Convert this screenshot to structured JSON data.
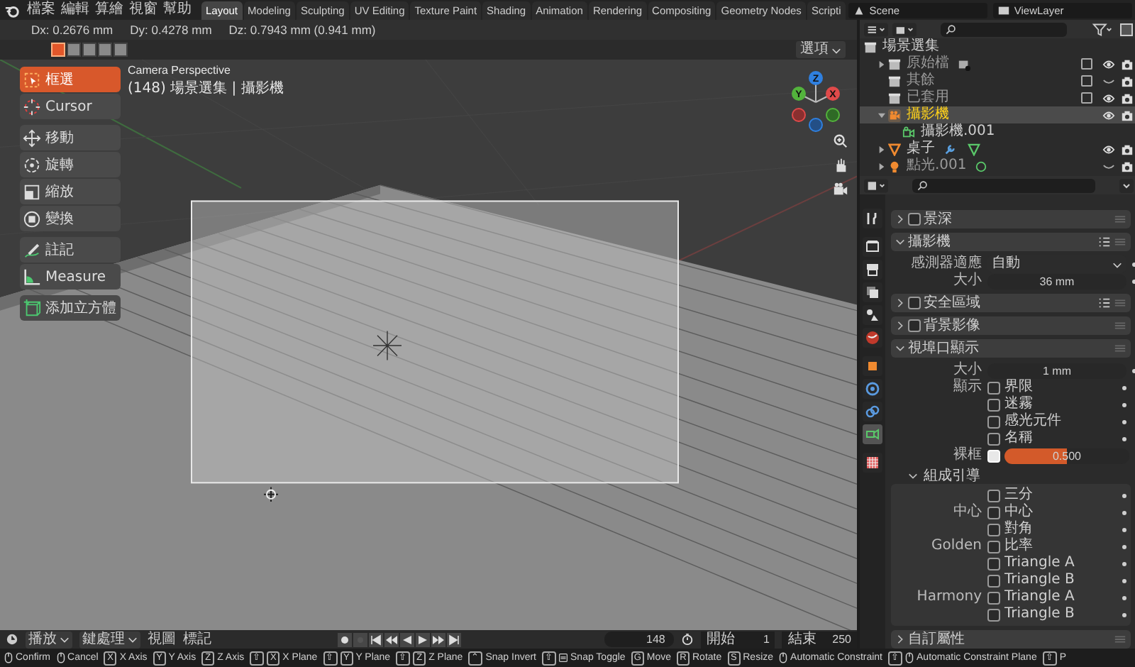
{
  "menu": [
    "檔案",
    "編輯",
    "算繪",
    "視窗",
    "幫助"
  ],
  "workspaces": [
    {
      "label": "Layout",
      "selected": true
    },
    {
      "label": "Modeling",
      "selected": false
    },
    {
      "label": "Sculpting",
      "selected": false
    },
    {
      "label": "UV Editing",
      "selected": false
    },
    {
      "label": "Texture Paint",
      "selected": false
    },
    {
      "label": "Shading",
      "selected": false
    },
    {
      "label": "Animation",
      "selected": false
    },
    {
      "label": "Rendering",
      "selected": false
    },
    {
      "label": "Compositing",
      "selected": false
    },
    {
      "label": "Geometry Nodes",
      "selected": false
    },
    {
      "label": "Scripti",
      "selected": false
    }
  ],
  "scene": "Scene",
  "view_layer": "ViewLayer",
  "viewport": {
    "measurements": [
      "Dx: 0.2676 mm",
      "Dy: 0.4278 mm",
      "Dz: 0.7943 mm (0.941 mm)"
    ],
    "select_modes": [
      {
        "selected": true
      },
      {
        "selected": false
      },
      {
        "selected": false
      },
      {
        "selected": false
      },
      {
        "selected": false
      }
    ],
    "options": "選項",
    "camera_title": "Camera Perspective",
    "camera_info": "(148) 場景選集 | 攝影機",
    "tool_groups": [
      [
        {
          "label": "框選",
          "kind": "select-box",
          "selected": true
        },
        {
          "label": "Cursor",
          "kind": "cursor",
          "selected": false
        }
      ],
      [
        {
          "label": "移動",
          "kind": "move",
          "selected": false
        },
        {
          "label": "旋轉",
          "kind": "rotate",
          "selected": false
        },
        {
          "label": "縮放",
          "kind": "scale",
          "selected": false
        },
        {
          "label": "變換",
          "kind": "transform",
          "selected": false
        }
      ],
      [
        {
          "label": "註記",
          "kind": "annotate",
          "selected": false
        },
        {
          "label": "Measure",
          "kind": "measure",
          "selected": false
        }
      ],
      [
        {
          "label": "添加立方體",
          "kind": "add-cube",
          "selected": false
        }
      ]
    ],
    "gizmo": [
      {
        "label": "Z",
        "color": "#2f80e0"
      },
      {
        "label": "Y",
        "color": "#53b33c"
      },
      {
        "label": "X",
        "color": "#e04a4a"
      }
    ]
  },
  "timeline": {
    "menus": [
      "播放",
      "鍵處理"
    ],
    "links": [
      "視圖",
      "標記"
    ],
    "frame": "148",
    "start_label": "開始",
    "start": "1",
    "end_label": "結束",
    "end": "250"
  },
  "outliner": {
    "root": "場景選集",
    "items": [
      {
        "label": "原始檔",
        "kind": "collection",
        "expanded": false,
        "dimmed": true,
        "selected": false,
        "visible": true,
        "extras": [
          {
            "kind": "collection-count"
          }
        ]
      },
      {
        "label": "其餘",
        "kind": "collection",
        "dimmed": true,
        "selected": false,
        "visible": false
      },
      {
        "label": "已套用",
        "kind": "collection",
        "dimmed": true,
        "selected": false,
        "visible": true
      },
      {
        "label": "攝影機",
        "kind": "camera",
        "expanded": true,
        "dimmed": false,
        "selected": true,
        "visible": true,
        "children": [
          {
            "label": "攝影機.001",
            "kind": "camera-data"
          }
        ]
      },
      {
        "label": "桌子",
        "kind": "mesh",
        "expanded": false,
        "dimmed": false,
        "selected": false,
        "visible": true,
        "extras": [
          {
            "kind": "modifier"
          },
          {
            "kind": "mesh-data"
          }
        ]
      },
      {
        "label": "點光.001",
        "kind": "light",
        "expanded": false,
        "dimmed": true,
        "selected": false,
        "visible": false,
        "extras": [
          {
            "kind": "light-data"
          }
        ]
      }
    ]
  },
  "properties": {
    "tabs": [
      [
        {
          "kind": "tool",
          "selected": false
        }
      ],
      [
        {
          "kind": "render",
          "selected": false
        },
        {
          "kind": "output",
          "selected": false
        },
        {
          "kind": "view-layer",
          "selected": false
        },
        {
          "kind": "scene",
          "selected": false
        },
        {
          "kind": "world",
          "selected": false
        }
      ],
      [
        {
          "kind": "object",
          "selected": false
        },
        {
          "kind": "physics",
          "selected": false
        },
        {
          "kind": "constraint",
          "selected": false
        },
        {
          "kind": "camera-data",
          "selected": true
        }
      ],
      [
        {
          "kind": "texture",
          "selected": false
        }
      ]
    ],
    "panels": [
      {
        "title": "景深",
        "expanded": false,
        "checked": false
      },
      {
        "title": "攝影機",
        "expanded": true,
        "presets": true,
        "rows": [
          {
            "kind": "dropdown",
            "label": "感測器適應",
            "value": "自動"
          },
          {
            "kind": "number",
            "label": "大小",
            "value": "36 mm"
          }
        ]
      },
      {
        "title": "安全區域",
        "expanded": false,
        "checked": false,
        "presets": true
      },
      {
        "title": "背景影像",
        "expanded": false,
        "checked": false
      },
      {
        "title": "視埠口顯示",
        "expanded": true,
        "rows": [
          {
            "kind": "number",
            "label": "大小",
            "value": "1 mm"
          },
          {
            "kind": "check",
            "label": "顯示",
            "text": "界限",
            "checked": false
          },
          {
            "kind": "check",
            "text": "迷霧",
            "checked": false
          },
          {
            "kind": "check",
            "text": "感光元件",
            "checked": false
          },
          {
            "kind": "check",
            "text": "名稱",
            "checked": false
          },
          {
            "kind": "slider",
            "label": "裸框",
            "checked": true,
            "value": "0.500",
            "level": 0.5
          },
          {
            "kind": "subpanel",
            "title": "組成引導",
            "expanded": true,
            "rows": [
              {
                "kind": "check",
                "text": "三分",
                "checked": false
              },
              {
                "kind": "check",
                "label": "中心",
                "text": "中心",
                "checked": false
              },
              {
                "kind": "check",
                "text": "對角",
                "checked": false
              },
              {
                "kind": "check",
                "label": "Golden",
                "text": "比率",
                "checked": false
              },
              {
                "kind": "check",
                "text": "Triangle A",
                "checked": false
              },
              {
                "kind": "check",
                "text": "Triangle B",
                "checked": false
              },
              {
                "kind": "check",
                "label": "Harmony",
                "text": "Triangle A",
                "checked": false
              },
              {
                "kind": "check",
                "text": "Triangle B",
                "checked": false
              }
            ]
          }
        ]
      },
      {
        "title": "自訂屬性",
        "expanded": false
      }
    ]
  },
  "status_bar": [
    {
      "kind": "mouse",
      "text": "Confirm"
    },
    {
      "kind": "mouse",
      "text": "Cancel"
    },
    {
      "keys": [
        "X"
      ],
      "text": "X Axis"
    },
    {
      "keys": [
        "Y"
      ],
      "text": "Y Axis"
    },
    {
      "keys": [
        "Z"
      ],
      "text": "Z Axis"
    },
    {
      "keys": [
        "⇧",
        "X"
      ],
      "text": "X Plane"
    },
    {
      "keys": [
        "⇧",
        "Y"
      ],
      "text": "Y Plane"
    },
    {
      "keys": [
        "⇧",
        "Z"
      ],
      "text": "Z Plane"
    },
    {
      "keys": [
        "⌃"
      ],
      "text": "Snap Invert"
    },
    {
      "keys": [
        "⇧"
      ],
      "kind": "snap",
      "text": "Snap Toggle"
    },
    {
      "keys": [
        "G"
      ],
      "text": "Move"
    },
    {
      "keys": [
        "R"
      ],
      "text": "Rotate"
    },
    {
      "keys": [
        "S"
      ],
      "text": "Resize"
    },
    {
      "kind": "mouse",
      "text": "Automatic Constraint"
    },
    {
      "keys": [
        "⇧"
      ],
      "kind": "mouse",
      "text": "Automatic Constraint Plane"
    },
    {
      "keys": [
        "⇧"
      ],
      "text": "P"
    }
  ]
}
